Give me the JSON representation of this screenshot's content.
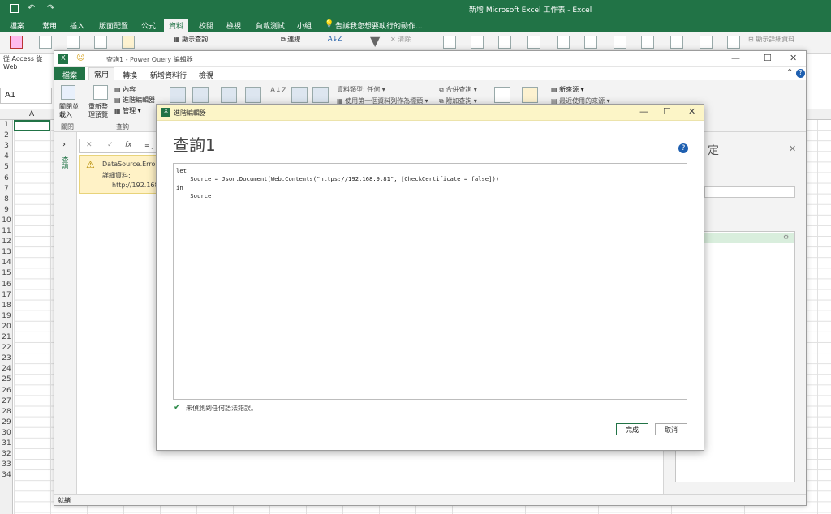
{
  "excel": {
    "title": "新增 Microsoft Excel 工作表 - Excel",
    "tabs": [
      "檔案",
      "常用",
      "插入",
      "版面配置",
      "公式",
      "資料",
      "校閱",
      "檢視",
      "負載測試",
      "小組"
    ],
    "tell_me": "告訴我您想要執行的動作...",
    "ribbon_labels": {
      "show_queries": "顯示查詢",
      "connections": "連線",
      "clear": "清除",
      "show_detail": "顯示詳細資料"
    },
    "left_labels": "從 Access 從 Web",
    "name_box": "A1",
    "column_a": "A",
    "rows": [
      "1",
      "2",
      "3",
      "4",
      "5",
      "6",
      "7",
      "8",
      "9",
      "10",
      "11",
      "12",
      "13",
      "14",
      "15",
      "16",
      "17",
      "18",
      "19",
      "20",
      "21",
      "22",
      "23",
      "24",
      "25",
      "26",
      "27",
      "28",
      "29",
      "30",
      "31",
      "32",
      "33",
      "34"
    ]
  },
  "pq": {
    "title": "查詢1 - Power Query 編輯器",
    "tabs": {
      "file": "檔案",
      "home": "常用",
      "transform": "轉換",
      "add_column": "新增資料行",
      "view": "檢視"
    },
    "ribbon": {
      "close_load": "關閉並\n載入",
      "refresh_preview": "重新整\n理預覽",
      "properties": "內容",
      "advanced_editor": "進階編輯器",
      "manage": "管理",
      "group_close": "關閉",
      "group_query": "查詢",
      "data_type": "資料類型: 任何",
      "use_first_row": "使用第一個資料列作為標頭",
      "merge_queries": "合併查詢",
      "append_queries": "附加查詢",
      "new_source": "新來源",
      "recent_sources": "最近使用的來源"
    },
    "queries_label": "查詢",
    "formula": "= J",
    "error": {
      "title": "DataSource.Error: 8",
      "detail_label": "詳細資料:",
      "url": "http://192.168.9."
    },
    "settings_title": "定",
    "status": "就緒"
  },
  "dialog": {
    "title": "進階編輯器",
    "heading": "查詢1",
    "code": "let\n    Source = Json.Document(Web.Contents(\"https://192.168.9.81\", [CheckCertificate = false]))\nin\n    Source\n",
    "status": "未偵測到任何語法錯誤。",
    "done_label": "完成",
    "cancel_label": "取消"
  }
}
